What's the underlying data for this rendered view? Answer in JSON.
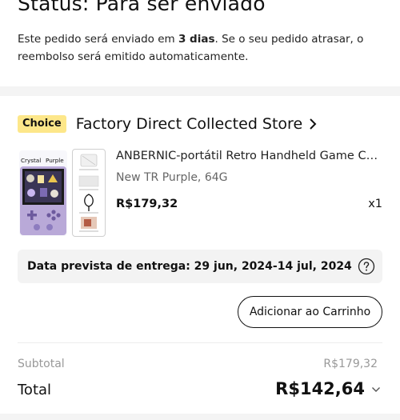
{
  "status": {
    "title": "Status: Para ser enviado",
    "desc_prefix": "Este pedido será enviado em ",
    "desc_days": "3 dias",
    "desc_suffix": ". Se o seu pedido atrasar, o reembolso será emitido automaticamente."
  },
  "store": {
    "badge": "Choice",
    "name": "Factory Direct Collected Store"
  },
  "product": {
    "image_label_left": "Crystal",
    "image_label_right": "Purple",
    "title": "ANBERNIC-portátil Retro Handheld Game Console",
    "variant": "New TR Purple, 64G",
    "price": "R$179,32",
    "quantity": "x1"
  },
  "delivery": {
    "text": "Data prevista de entrega: 29 jun, 2024-14 jul, 2024"
  },
  "actions": {
    "add_to_cart": "Adicionar ao Carrinho"
  },
  "summary": {
    "subtotal_label": "Subtotal",
    "subtotal_value": "R$179,32",
    "total_label": "Total",
    "total_value": "R$142,64"
  },
  "colors": {
    "choice_badge": "#fde78a",
    "delivery_box": "#f3f3f3"
  }
}
